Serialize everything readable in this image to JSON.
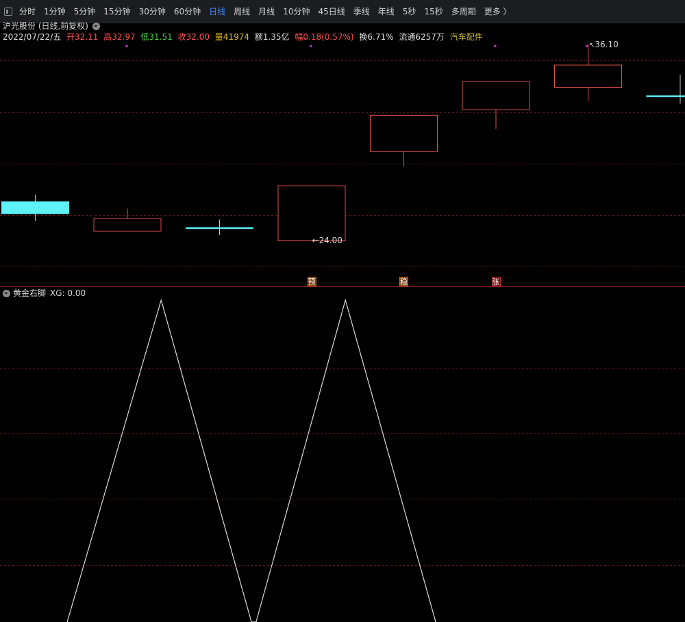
{
  "toolbar": {
    "items": [
      {
        "label": "分时"
      },
      {
        "label": "1分钟"
      },
      {
        "label": "5分钟"
      },
      {
        "label": "15分钟"
      },
      {
        "label": "30分钟"
      },
      {
        "label": "60分钟"
      },
      {
        "label": "日线",
        "active": true
      },
      {
        "label": "周线"
      },
      {
        "label": "月线"
      },
      {
        "label": "10分钟"
      },
      {
        "label": "45日线"
      },
      {
        "label": "季线"
      },
      {
        "label": "年线"
      },
      {
        "label": "5秒"
      },
      {
        "label": "15秒"
      },
      {
        "label": "多周期"
      }
    ],
    "more_label": "更多 〉"
  },
  "stock": {
    "title": "沪光股份 (日线,前复权)"
  },
  "quote": {
    "date": "2022/07/22/五",
    "open": "开32.11",
    "high": "高32.97",
    "low": "低31.51",
    "close": "收32.00",
    "volume": "量41974",
    "amount": "额1.35亿",
    "change": "幅0.18(0.57%)",
    "turnover": "换6.71%",
    "float": "流通6257万",
    "sector": "汽车配件"
  },
  "colors": {
    "up": "#e0504a",
    "down": "#5df2f8",
    "grid": "#5a1414",
    "line": "#dcdcdc",
    "marker": "#c040c0"
  },
  "chart_data": {
    "type": "candlestick",
    "price_range": [
      21.5,
      38.0
    ],
    "candles": [
      {
        "open": 26.8,
        "close": 25.9,
        "high": 27.3,
        "low": 25.4,
        "dir": "down"
      },
      {
        "open": 24.7,
        "close": 25.6,
        "high": 26.3,
        "low": 24.7,
        "dir": "up"
      },
      {
        "open": 24.95,
        "close": 24.95,
        "high": 25.5,
        "low": 24.4,
        "dir": "down"
      },
      {
        "open": 24.0,
        "close": 27.95,
        "high": 27.95,
        "low": 24.0,
        "dir": "up"
      },
      {
        "open": 30.4,
        "close": 33.0,
        "high": 33.0,
        "low": 29.3,
        "dir": "up"
      },
      {
        "open": 33.4,
        "close": 35.4,
        "high": 35.4,
        "low": 32.0,
        "dir": "up"
      },
      {
        "open": 35.0,
        "close": 36.6,
        "high": 38.1,
        "low": 34.0,
        "dir": "up"
      },
      {
        "open": 34.4,
        "close": 34.4,
        "high": 35.9,
        "low": 33.8,
        "dir": "down"
      }
    ],
    "annotations": {
      "low_label": "24.00",
      "high_label": "36.10"
    },
    "signals": [
      {
        "index": 3,
        "label": "预",
        "style": "orange"
      },
      {
        "index": 4,
        "label": "稳",
        "style": "orange"
      },
      {
        "index": 5,
        "label": "张",
        "style": "red"
      }
    ],
    "indicator": {
      "name": "黄金右脚",
      "value_text": "XG: 0.00",
      "range": [
        0,
        1
      ],
      "points": [
        [
          0.35,
          0
        ],
        [
          1.37,
          1
        ],
        [
          2.35,
          0
        ],
        [
          2.4,
          0
        ],
        [
          3.37,
          1
        ],
        [
          4.35,
          0
        ]
      ]
    }
  }
}
